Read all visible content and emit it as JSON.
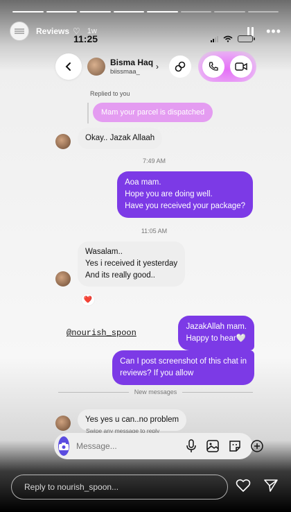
{
  "story": {
    "title": "Reviews",
    "time_ago": "1w",
    "progress_total": 8,
    "progress_done": 5
  },
  "status_bar": {
    "clock": "11:25"
  },
  "chat": {
    "name": "Bisma Haq",
    "handle": "biissmaa_",
    "replied_label": "Replied to you",
    "quoted_reply": "Mam your parcel is dispatched",
    "msg_1": "Okay.. Jazak Allaah",
    "time_1": "7:49 AM",
    "out_1": [
      "Aoa mam.",
      "Hope you are doing well.",
      "Have you received your package?"
    ],
    "time_2": "11:05 AM",
    "in_2": [
      "Wasalam..",
      "Yes i received it yesterday",
      "And its really good.."
    ],
    "reaction": "❤️",
    "sticker": "@nourish_spoon",
    "out_2": [
      "JazakAllah mam.",
      "Happy to hear🤍"
    ],
    "out_3": [
      "Can I post screenshot of this chat in",
      "reviews? If you allow"
    ],
    "new_messages_label": "New messages",
    "in_3": "Yes yes u can..no problem",
    "swipe_hint": "Swipe any message to reply",
    "composer_placeholder": "Message..."
  },
  "story_reply": {
    "placeholder": "Reply to nourish_spoon..."
  },
  "colors": {
    "outgoing_bubble": "#7c3ae6",
    "quoted_bubble": "#e49cf1",
    "camera_button": "#5b4ce0"
  },
  "icons": [
    "pause-icon",
    "more-icon",
    "back-icon",
    "link-icon",
    "phone-icon",
    "video-icon",
    "camera-icon",
    "mic-icon",
    "gallery-icon",
    "sticker-icon",
    "plus-icon",
    "heart-icon",
    "send-icon"
  ]
}
